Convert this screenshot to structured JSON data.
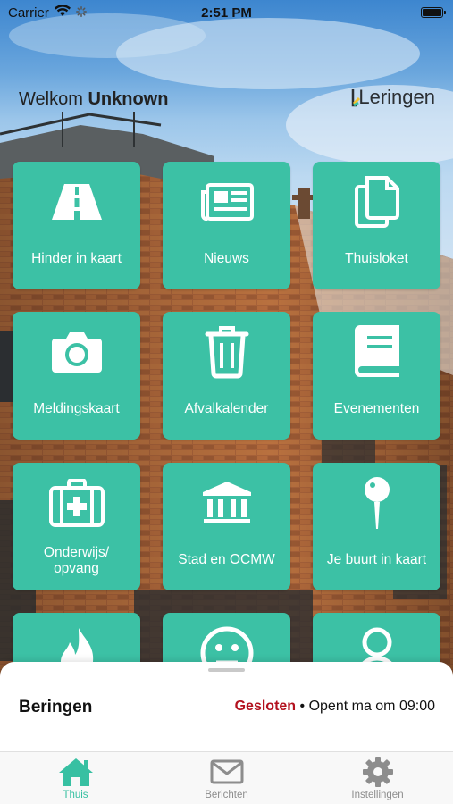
{
  "status_bar": {
    "carrier": "Carrier",
    "time": "2:51 PM"
  },
  "header": {
    "welcome_prefix": "Welkom",
    "welcome_name": "Unknown",
    "logo_text": "Leringen"
  },
  "tiles": [
    {
      "label": "Hinder in kaart",
      "icon": "road-icon"
    },
    {
      "label": "Nieuws",
      "icon": "newspaper-icon"
    },
    {
      "label": "Thuisloket",
      "icon": "documents-icon"
    },
    {
      "label": "Meldingskaart",
      "icon": "camera-icon"
    },
    {
      "label": "Afvalkalender",
      "icon": "trash-icon"
    },
    {
      "label": "Evenementen",
      "icon": "book-icon"
    },
    {
      "label": "Onderwijs/\nopvang",
      "icon": "first-aid-kit-icon"
    },
    {
      "label": "Stad en OCMW",
      "icon": "city-hall-icon"
    },
    {
      "label": "Je buurt in kaart",
      "icon": "map-pin-icon"
    },
    {
      "label": "",
      "icon": "flame-icon"
    },
    {
      "label": "",
      "icon": "smiley-icon"
    },
    {
      "label": "",
      "icon": "person-icon"
    }
  ],
  "info_sheet": {
    "place": "Beringen",
    "status": "Gesloten",
    "separator": " • ",
    "opening": "Opent ma om 09:00"
  },
  "tab_bar": {
    "tabs": [
      {
        "label": "Thuis",
        "icon": "home-icon",
        "active": true
      },
      {
        "label": "Berichten",
        "icon": "envelope-icon",
        "active": false
      },
      {
        "label": "Instellingen",
        "icon": "gear-icon",
        "active": false
      }
    ]
  },
  "colors": {
    "tile": "#3cc1a5",
    "accent": "#37c0a2",
    "closed": "#b3121f"
  }
}
